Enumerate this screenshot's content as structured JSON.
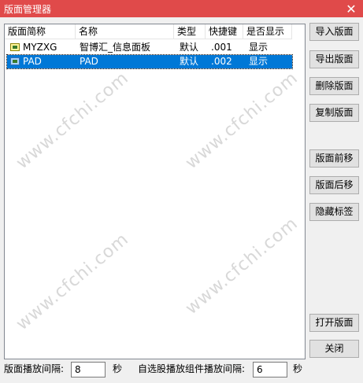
{
  "window": {
    "title": "版面管理器",
    "close_glyph": "✕"
  },
  "table": {
    "columns": [
      "版面简称",
      "名称",
      "类型",
      "快捷键",
      "是否显示"
    ],
    "rows": [
      {
        "short": "MYZXG",
        "name": "智博汇_信息面板",
        "type": "默认",
        "hotkey": ".001",
        "visible": "显示",
        "icon": "panel-icon-yellow",
        "selected": false
      },
      {
        "short": "PAD",
        "name": "PAD",
        "type": "默认",
        "hotkey": ".002",
        "visible": "显示",
        "icon": "panel-icon-blue",
        "selected": true
      }
    ]
  },
  "watermark": "www.cfchi.com",
  "buttons": {
    "import": "导入版面",
    "export": "导出版面",
    "delete": "删除版面",
    "copy": "复制版面",
    "move_up": "版面前移",
    "move_down": "版面后移",
    "hide_tabs": "隐藏标签",
    "open": "打开版面",
    "close": "关闭"
  },
  "footer": {
    "interval_label": "版面播放间隔:",
    "interval_value": "8",
    "interval_unit": "秒",
    "stock_interval_label": "自选股播放组件播放间隔:",
    "stock_interval_value": "6",
    "stock_interval_unit": "秒"
  },
  "colors": {
    "titlebar": "#e04a4a",
    "selection": "#0078d7"
  }
}
